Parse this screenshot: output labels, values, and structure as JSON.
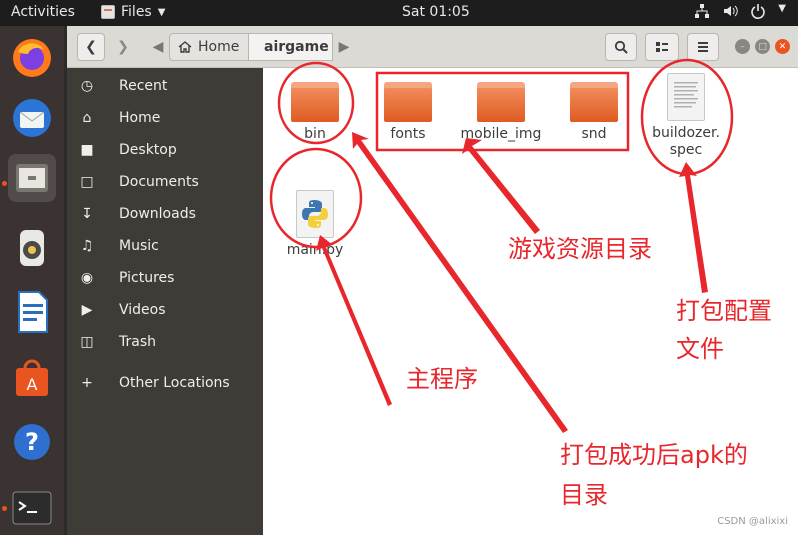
{
  "topbar": {
    "activities": "Activities",
    "app_name": "Files",
    "clock": "Sat 01:05"
  },
  "toolbar": {
    "breadcrumbs": [
      "Home",
      "airgame"
    ]
  },
  "sidebar": {
    "items": [
      {
        "label": "Recent",
        "icon": "clock-icon"
      },
      {
        "label": "Home",
        "icon": "home-icon"
      },
      {
        "label": "Desktop",
        "icon": "desktop-folder-icon"
      },
      {
        "label": "Documents",
        "icon": "document-icon"
      },
      {
        "label": "Downloads",
        "icon": "download-icon"
      },
      {
        "label": "Music",
        "icon": "music-icon"
      },
      {
        "label": "Pictures",
        "icon": "camera-icon"
      },
      {
        "label": "Videos",
        "icon": "video-icon"
      },
      {
        "label": "Trash",
        "icon": "trash-icon"
      },
      {
        "label": "Other Locations",
        "icon": "plus-icon"
      }
    ]
  },
  "files": [
    {
      "name": "bin",
      "type": "folder"
    },
    {
      "name": "fonts",
      "type": "folder"
    },
    {
      "name": "mobile_img",
      "type": "folder"
    },
    {
      "name": "snd",
      "type": "folder"
    },
    {
      "name": "buildozer.\nspec",
      "type": "text-file"
    },
    {
      "name": "main.py",
      "type": "python-file"
    }
  ],
  "annotations": {
    "game_resources": "游戏资源目录",
    "packaging_config_line1": "打包配置",
    "packaging_config_line2": "文件",
    "main_program": "主程序",
    "apk_dir_line1": "打包成功后apk的",
    "apk_dir_line2": "目录",
    "color": "#e8272c"
  },
  "watermark": "CSDN @alixixi",
  "colors": {
    "accent": "#e95420",
    "sidebar_bg": "#3f3c37",
    "dock_bg": "#3a3331"
  }
}
